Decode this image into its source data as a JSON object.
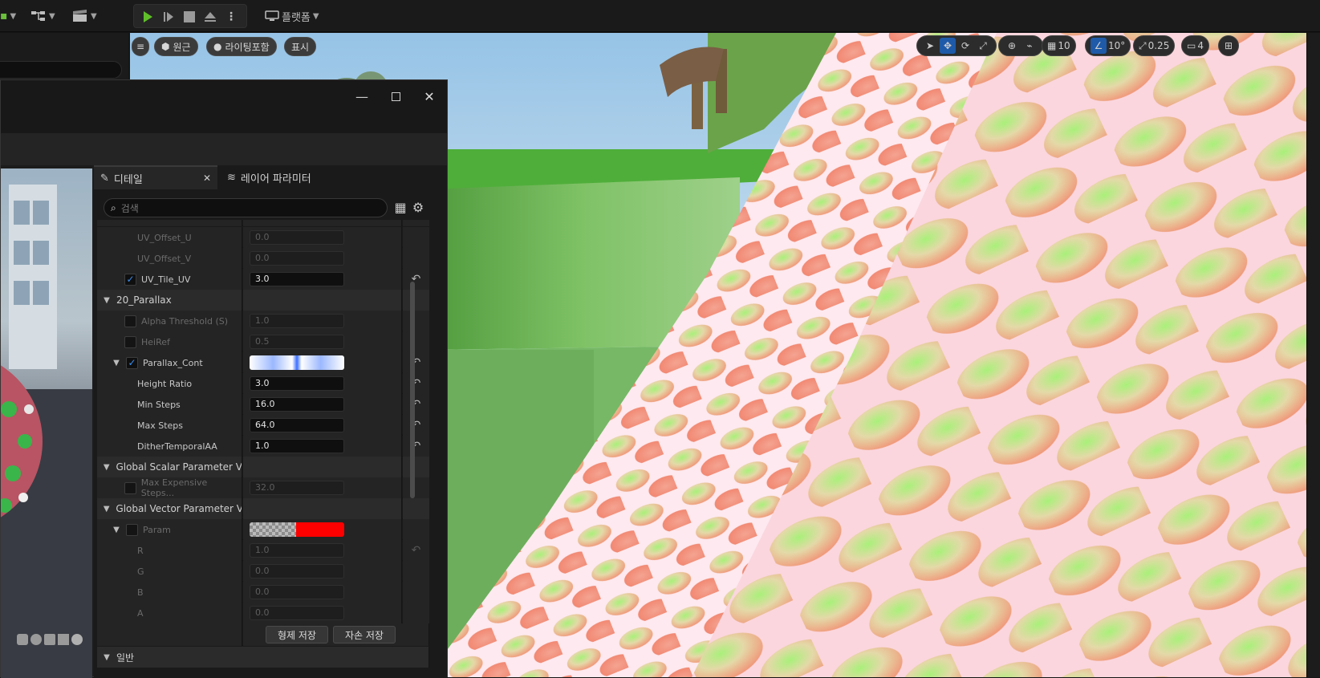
{
  "toolbar": {
    "platform_label": "플랫폼"
  },
  "viewport": {
    "menu_label": "≡",
    "perspective_label": "원근",
    "lighting_label": "라이팅포함",
    "show_label": "표시",
    "grid_snap_value": "10",
    "rotation_snap_value": "10°",
    "scale_snap_value": "0.25",
    "camera_speed_value": "4"
  },
  "details": {
    "tab_details_label": "디테일",
    "tab_layer_label": "레이어 파라미터",
    "search_placeholder": "검색",
    "rows": [
      {
        "label": "UV_Offset_U",
        "value": "0.0",
        "checked": false,
        "enabled": false
      },
      {
        "label": "UV_Offset_V",
        "value": "0.0",
        "checked": false,
        "enabled": false
      },
      {
        "label": "UV_Tile_UV",
        "value": "3.0",
        "checked": true,
        "enabled": true
      },
      {
        "category": "20_Parallax"
      },
      {
        "label": "Alpha Threshold (S)",
        "value": "1.0",
        "checked": false,
        "enabled": false
      },
      {
        "label": "HeiRef",
        "value": "0.5",
        "checked": false,
        "enabled": false
      },
      {
        "label": "Parallax_Cont",
        "checked": true,
        "enabled": true
      },
      {
        "label": "Height Ratio",
        "value": "3.0",
        "enabled": true
      },
      {
        "label": "Min Steps",
        "value": "16.0",
        "enabled": true
      },
      {
        "label": "Max Steps",
        "value": "64.0",
        "enabled": true
      },
      {
        "label": "DitherTemporalAA",
        "value": "1.0",
        "enabled": true
      },
      {
        "category": "Global Scalar Parameter Va"
      },
      {
        "label": "Max Expensive Steps...",
        "value": "32.0",
        "checked": false,
        "enabled": false
      },
      {
        "category": "Global Vector Parameter Va"
      },
      {
        "label": "Param",
        "checked": false,
        "enabled": false
      },
      {
        "label": "R",
        "value": "1.0",
        "enabled": false
      },
      {
        "label": "G",
        "value": "0.0",
        "enabled": false
      },
      {
        "label": "B",
        "value": "0.0",
        "enabled": false
      },
      {
        "label": "A",
        "value": "0.0",
        "enabled": false
      }
    ],
    "save_sibling_label": "형제 저장",
    "save_child_label": "자손 저장",
    "general_category": "일반"
  }
}
